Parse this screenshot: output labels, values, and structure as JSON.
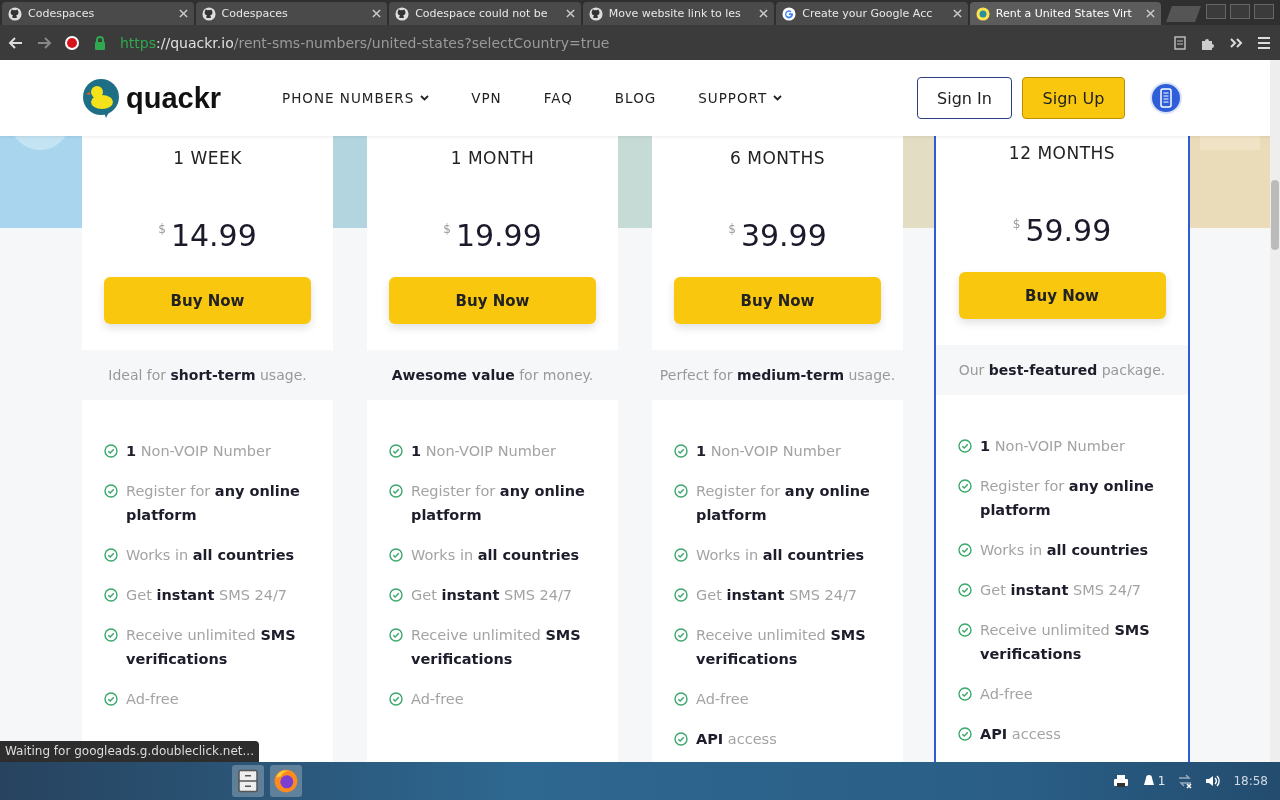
{
  "browser": {
    "tabs": [
      {
        "title": "Codespaces",
        "kind": "github",
        "selected": false
      },
      {
        "title": "Codespaces",
        "kind": "github",
        "selected": false
      },
      {
        "title": "Codespace could not be",
        "kind": "github",
        "selected": false
      },
      {
        "title": "Move website link to les",
        "kind": "github",
        "selected": false
      },
      {
        "title": "Create your Google Acc",
        "kind": "google",
        "selected": false
      },
      {
        "title": "Rent a United States Virt",
        "kind": "duck",
        "selected": true
      }
    ],
    "url_scheme": "https",
    "url_rest": "://quackr.io/rent-sms-numbers/united-states?selectCountry=true"
  },
  "header": {
    "logo": "quackr",
    "nav": [
      {
        "label": "PHONE NUMBERS",
        "dropdown": true
      },
      {
        "label": "VPN",
        "dropdown": false
      },
      {
        "label": "FAQ",
        "dropdown": false
      },
      {
        "label": "BLOG",
        "dropdown": false
      },
      {
        "label": "SUPPORT",
        "dropdown": true
      }
    ],
    "sign_in": "Sign In",
    "sign_up": "Sign Up"
  },
  "plans": [
    {
      "title": "1 WEEK",
      "currency": "$",
      "price": "14.99",
      "button": "Buy Now",
      "tagline": "Ideal for **short-term** usage.",
      "featured": false,
      "features": [
        "**1** Non-VOIP Number",
        "Register for **any online platform**",
        "Works in **all countries**",
        "Get **instant** SMS 24/7",
        "Receive unlimited **SMS verifications**",
        "Ad-free"
      ]
    },
    {
      "title": "1 MONTH",
      "currency": "$",
      "price": "19.99",
      "button": "Buy Now",
      "tagline": "**Awesome value** for money.",
      "featured": false,
      "features": [
        "**1** Non-VOIP Number",
        "Register for **any online platform**",
        "Works in **all countries**",
        "Get **instant** SMS 24/7",
        "Receive unlimited **SMS verifications**",
        "Ad-free"
      ]
    },
    {
      "title": "6 MONTHS",
      "currency": "$",
      "price": "39.99",
      "button": "Buy Now",
      "tagline": "Perfect for **medium-term** usage.",
      "featured": false,
      "features": [
        "**1** Non-VOIP Number",
        "Register for **any online platform**",
        "Works in **all countries**",
        "Get **instant** SMS 24/7",
        "Receive unlimited **SMS verifications**",
        "Ad-free",
        "**API** access"
      ]
    },
    {
      "title": "12 MONTHS",
      "currency": "$",
      "price": "59.99",
      "button": "Buy Now",
      "tagline": "Our **best-featured** package.",
      "featured": true,
      "features": [
        "**1** Non-VOIP Number",
        "Register for **any online platform**",
        "Works in **all countries**",
        "Get **instant** SMS 24/7",
        "Receive unlimited **SMS verifications**",
        "Ad-free",
        "**API** access"
      ]
    }
  ],
  "status": "Waiting for googleads.g.doubleclick.net...",
  "taskbar": {
    "notifications": "1",
    "clock": "18:58"
  }
}
